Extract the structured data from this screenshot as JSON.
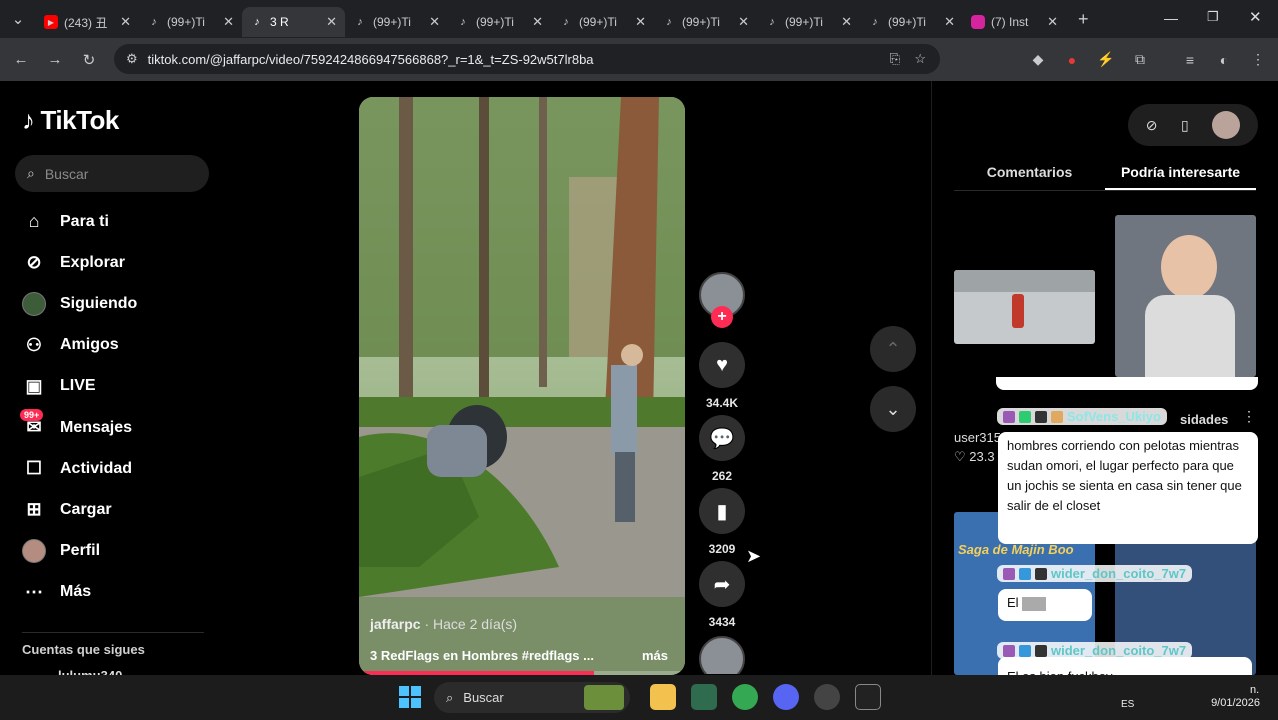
{
  "browser": {
    "tabs": [
      {
        "title": "(243) 丑",
        "icon": "youtube-icon"
      },
      {
        "title": "(99+)Ti",
        "icon": "tiktok-icon"
      },
      {
        "title": "3 R",
        "icon": "tiktok-icon",
        "active": true
      },
      {
        "title": "(99+)Ti",
        "icon": "tiktok-icon"
      },
      {
        "title": "(99+)Ti",
        "icon": "tiktok-icon"
      },
      {
        "title": "(99+)Ti",
        "icon": "tiktok-icon"
      },
      {
        "title": "(99+)Ti",
        "icon": "tiktok-icon"
      },
      {
        "title": "(99+)Ti",
        "icon": "tiktok-icon"
      },
      {
        "title": "(99+)Ti",
        "icon": "tiktok-icon"
      },
      {
        "title": "(7) Inst",
        "icon": "instagram-icon"
      }
    ],
    "url": "tiktok.com/@jaffarpc/video/7592424866947566868?_r=1&_t=ZS-92w5t7lr8ba"
  },
  "sidebar": {
    "logo": "TikTok",
    "search_placeholder": "Buscar",
    "items": [
      {
        "label": "Para ti",
        "icon": "home-icon"
      },
      {
        "label": "Explorar",
        "icon": "compass-icon"
      },
      {
        "label": "Siguiendo",
        "icon": "following-avatar-icon"
      },
      {
        "label": "Amigos",
        "icon": "friends-icon"
      },
      {
        "label": "LIVE",
        "icon": "live-icon"
      },
      {
        "label": "Mensajes",
        "icon": "messages-icon",
        "badge": "99+"
      },
      {
        "label": "Actividad",
        "icon": "activity-icon"
      },
      {
        "label": "Cargar",
        "icon": "upload-icon"
      },
      {
        "label": "Perfil",
        "icon": "profile-avatar-icon"
      },
      {
        "label": "Más",
        "icon": "more-icon"
      }
    ],
    "following_heading": "Cuentas que sigues",
    "following_first": "lulumu340"
  },
  "video": {
    "author": "jaffarpc",
    "time": "· Hace 2 día(s)",
    "description": "3 RedFlags en Hombres #redflags ...",
    "more": "más",
    "progress": 0.72
  },
  "actions": {
    "likes": "34.4K",
    "comments": "262",
    "saves": "3209",
    "shares": "3434"
  },
  "right_panel": {
    "tabs": [
      "Comentarios",
      "Podría interesarte"
    ],
    "active_tab": "Podría interesarte",
    "user_partial": "user315",
    "likes_partial": "23.3",
    "side_label_partial": "sidades",
    "thumb_caption": "Saga de Majin Boo"
  },
  "chat": [
    {
      "user": "SofVens_Ukiyo",
      "text": "hombres corriendo con pelotas mientras sudan omori, el lugar perfecto para que un jochis se sienta en casa sin tener que salir de el closet"
    },
    {
      "user": "wider_don_coito_7w7",
      "text": "El"
    },
    {
      "user": "wider_don_coito_7w7",
      "text": "El   es bien fuckboy"
    }
  ],
  "taskbar": {
    "search_placeholder": "Buscar",
    "language": "ES",
    "date": "9/01/2026",
    "time_partial": "n."
  },
  "colors": {
    "accent": "#fe2c55",
    "teal_chat": "#5ec7c7"
  }
}
